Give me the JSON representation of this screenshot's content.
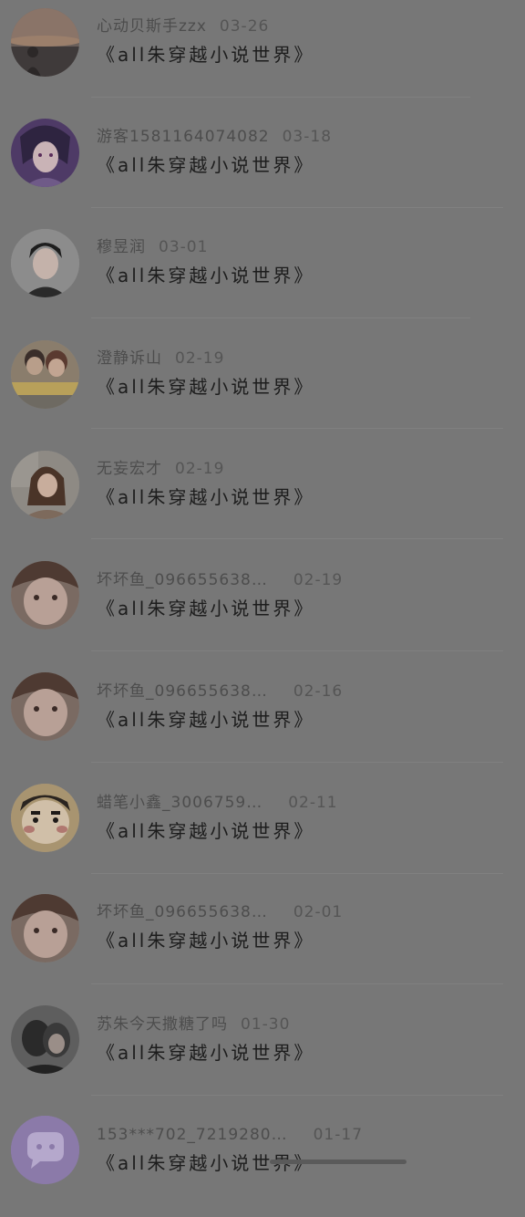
{
  "comments": [
    {
      "username": "心动贝斯手zzx",
      "date": "03-26",
      "title": "《all朱穿越小说世界》",
      "avatar_icon": "sunset-portrait-avatar"
    },
    {
      "username": "游客1581164074082",
      "date": "03-18",
      "title": "《all朱穿越小说世界》",
      "avatar_icon": "anime-character-avatar"
    },
    {
      "username": "穆昱润",
      "date": "03-01",
      "title": "《all朱穿越小说世界》",
      "avatar_icon": "boy-portrait-avatar"
    },
    {
      "username": "澄静诉山",
      "date": "02-19",
      "title": "《all朱穿越小说世界》",
      "avatar_icon": "couple-photo-avatar"
    },
    {
      "username": "无妄宏才",
      "date": "02-19",
      "title": "《all朱穿越小说世界》",
      "avatar_icon": "girl-portrait-avatar"
    },
    {
      "username": "坏坏鱼_096655638…",
      "date": "02-19",
      "title": "《all朱穿越小说世界》",
      "avatar_icon": "girl-selfie-avatar"
    },
    {
      "username": "坏坏鱼_096655638…",
      "date": "02-16",
      "title": "《all朱穿越小说世界》",
      "avatar_icon": "girl-selfie-avatar"
    },
    {
      "username": "蜡笔小鑫_3006759…",
      "date": "02-11",
      "title": "《all朱穿越小说世界》",
      "avatar_icon": "crayon-shinchan-avatar"
    },
    {
      "username": "坏坏鱼_096655638…",
      "date": "02-01",
      "title": "《all朱穿越小说世界》",
      "avatar_icon": "girl-selfie-avatar"
    },
    {
      "username": "苏朱今天撒糖了吗",
      "date": "01-30",
      "title": "《all朱穿越小说世界》",
      "avatar_icon": "couple-silhouette-avatar"
    },
    {
      "username": "153***702_7219280…",
      "date": "01-17",
      "title": "《all朱穿越小说世界》",
      "avatar_icon": "chat-bubble-avatar"
    }
  ],
  "colors": {
    "background": "#777777",
    "username": "#4d4d4d",
    "title": "#1d1d1d",
    "chat_avatar": "#9a85c4"
  }
}
